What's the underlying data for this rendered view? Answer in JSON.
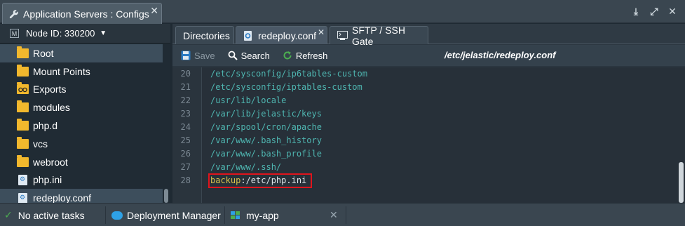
{
  "window": {
    "title": "Application Servers : Configs",
    "controls": [
      "download-icon",
      "expand-icon",
      "close-icon"
    ]
  },
  "sidebar": {
    "node_label": "Node ID: 330200",
    "node_badge": "M",
    "items": [
      {
        "label": "Root",
        "icon": "folder-icon",
        "selected": true
      },
      {
        "label": "Mount Points",
        "icon": "folder-icon"
      },
      {
        "label": "Exports",
        "icon": "exports-folder-icon"
      },
      {
        "label": "modules",
        "icon": "folder-icon"
      },
      {
        "label": "php.d",
        "icon": "folder-icon"
      },
      {
        "label": "vcs",
        "icon": "folder-icon"
      },
      {
        "label": "webroot",
        "icon": "folder-icon"
      },
      {
        "label": "php.ini",
        "icon": "config-file-icon"
      },
      {
        "label": "redeploy.conf",
        "icon": "config-file-icon",
        "selected": true
      }
    ]
  },
  "tabs": [
    {
      "label": "Directories"
    },
    {
      "label": "redeploy.conf",
      "active": true
    },
    {
      "label": "SFTP / SSH Gate"
    }
  ],
  "toolbar": {
    "save_label": "Save",
    "search_label": "Search",
    "refresh_label": "Refresh",
    "file_path": "/etc/jelastic/redeploy.conf"
  },
  "editor": {
    "lines": [
      {
        "num": "20",
        "text": "/etc/sysconfig/ip6tables-custom"
      },
      {
        "num": "21",
        "text": "/etc/sysconfig/iptables-custom"
      },
      {
        "num": "22",
        "text": "/usr/lib/locale"
      },
      {
        "num": "23",
        "text": "/var/lib/jelastic/keys"
      },
      {
        "num": "24",
        "text": "/var/spool/cron/apache"
      },
      {
        "num": "25",
        "text": "/var/www/.bash_history"
      },
      {
        "num": "26",
        "text": "/var/www/.bash_profile"
      },
      {
        "num": "27",
        "text": "/var/www/.ssh/"
      },
      {
        "num": "28",
        "keyword": "backup",
        "rest": ":/etc/php.ini"
      }
    ]
  },
  "statusbar": {
    "tasks_label": "No active tasks",
    "deployment_label": "Deployment Manager",
    "app_label": "my-app"
  },
  "colors": {
    "highlight_border": "#e0141c",
    "folder": "#f2b82d",
    "code_path": "#4fb6b1",
    "keyword": "#d8c34a"
  }
}
